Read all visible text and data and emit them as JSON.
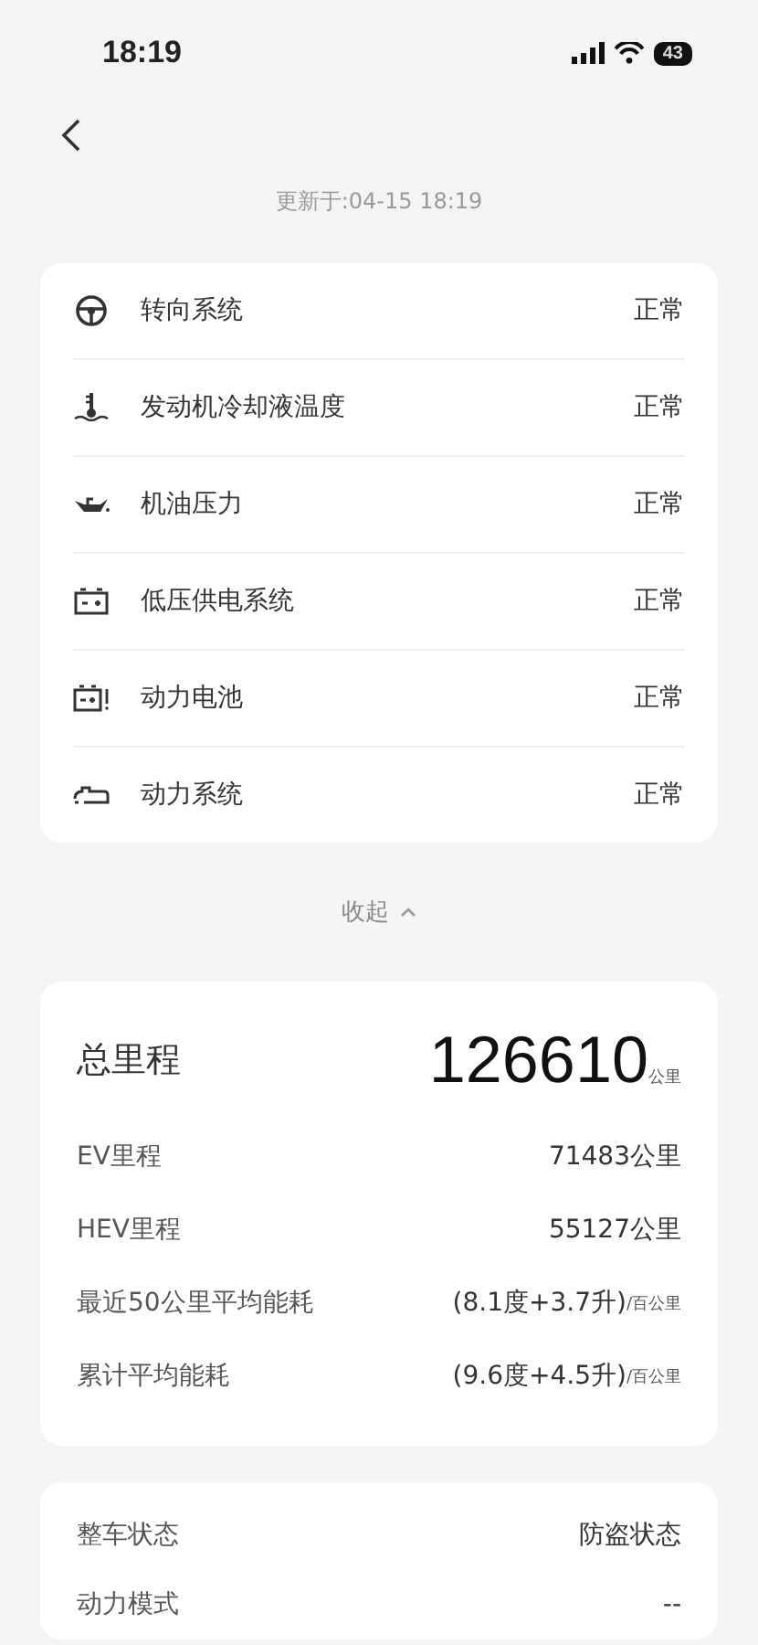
{
  "status_bar": {
    "time": "18:19",
    "battery": "43"
  },
  "header": {
    "updated": "更新于:04-15 18:19"
  },
  "systems": [
    {
      "kind": "steering",
      "name": "转向系统",
      "status": "正常"
    },
    {
      "kind": "coolant",
      "name": "发动机冷却液温度",
      "status": "正常"
    },
    {
      "kind": "oil",
      "name": "机油压力",
      "status": "正常"
    },
    {
      "kind": "battery",
      "name": "低压供电系统",
      "status": "正常"
    },
    {
      "kind": "battery-warning",
      "name": "动力电池",
      "status": "正常"
    },
    {
      "kind": "powertrain",
      "name": "动力系统",
      "status": "正常"
    }
  ],
  "collapse": {
    "label": "收起",
    "expanded": true
  },
  "mileage": {
    "total_label": "总里程",
    "total_value": "126610",
    "total_unit": "公里",
    "rows": [
      {
        "label": "EV里程",
        "value": "71483公里"
      },
      {
        "label": "HEV里程",
        "value": "55127公里"
      },
      {
        "label": "最近50公里平均能耗",
        "value": "(8.1度+3.7升)",
        "unit": "/百公里"
      },
      {
        "label": "累计平均能耗",
        "value": "(9.6度+4.5升)",
        "unit": "/百公里"
      }
    ]
  },
  "vehicle": [
    {
      "label": "整车状态",
      "value": "防盗状态"
    },
    {
      "label": "动力模式",
      "value": "--"
    }
  ]
}
